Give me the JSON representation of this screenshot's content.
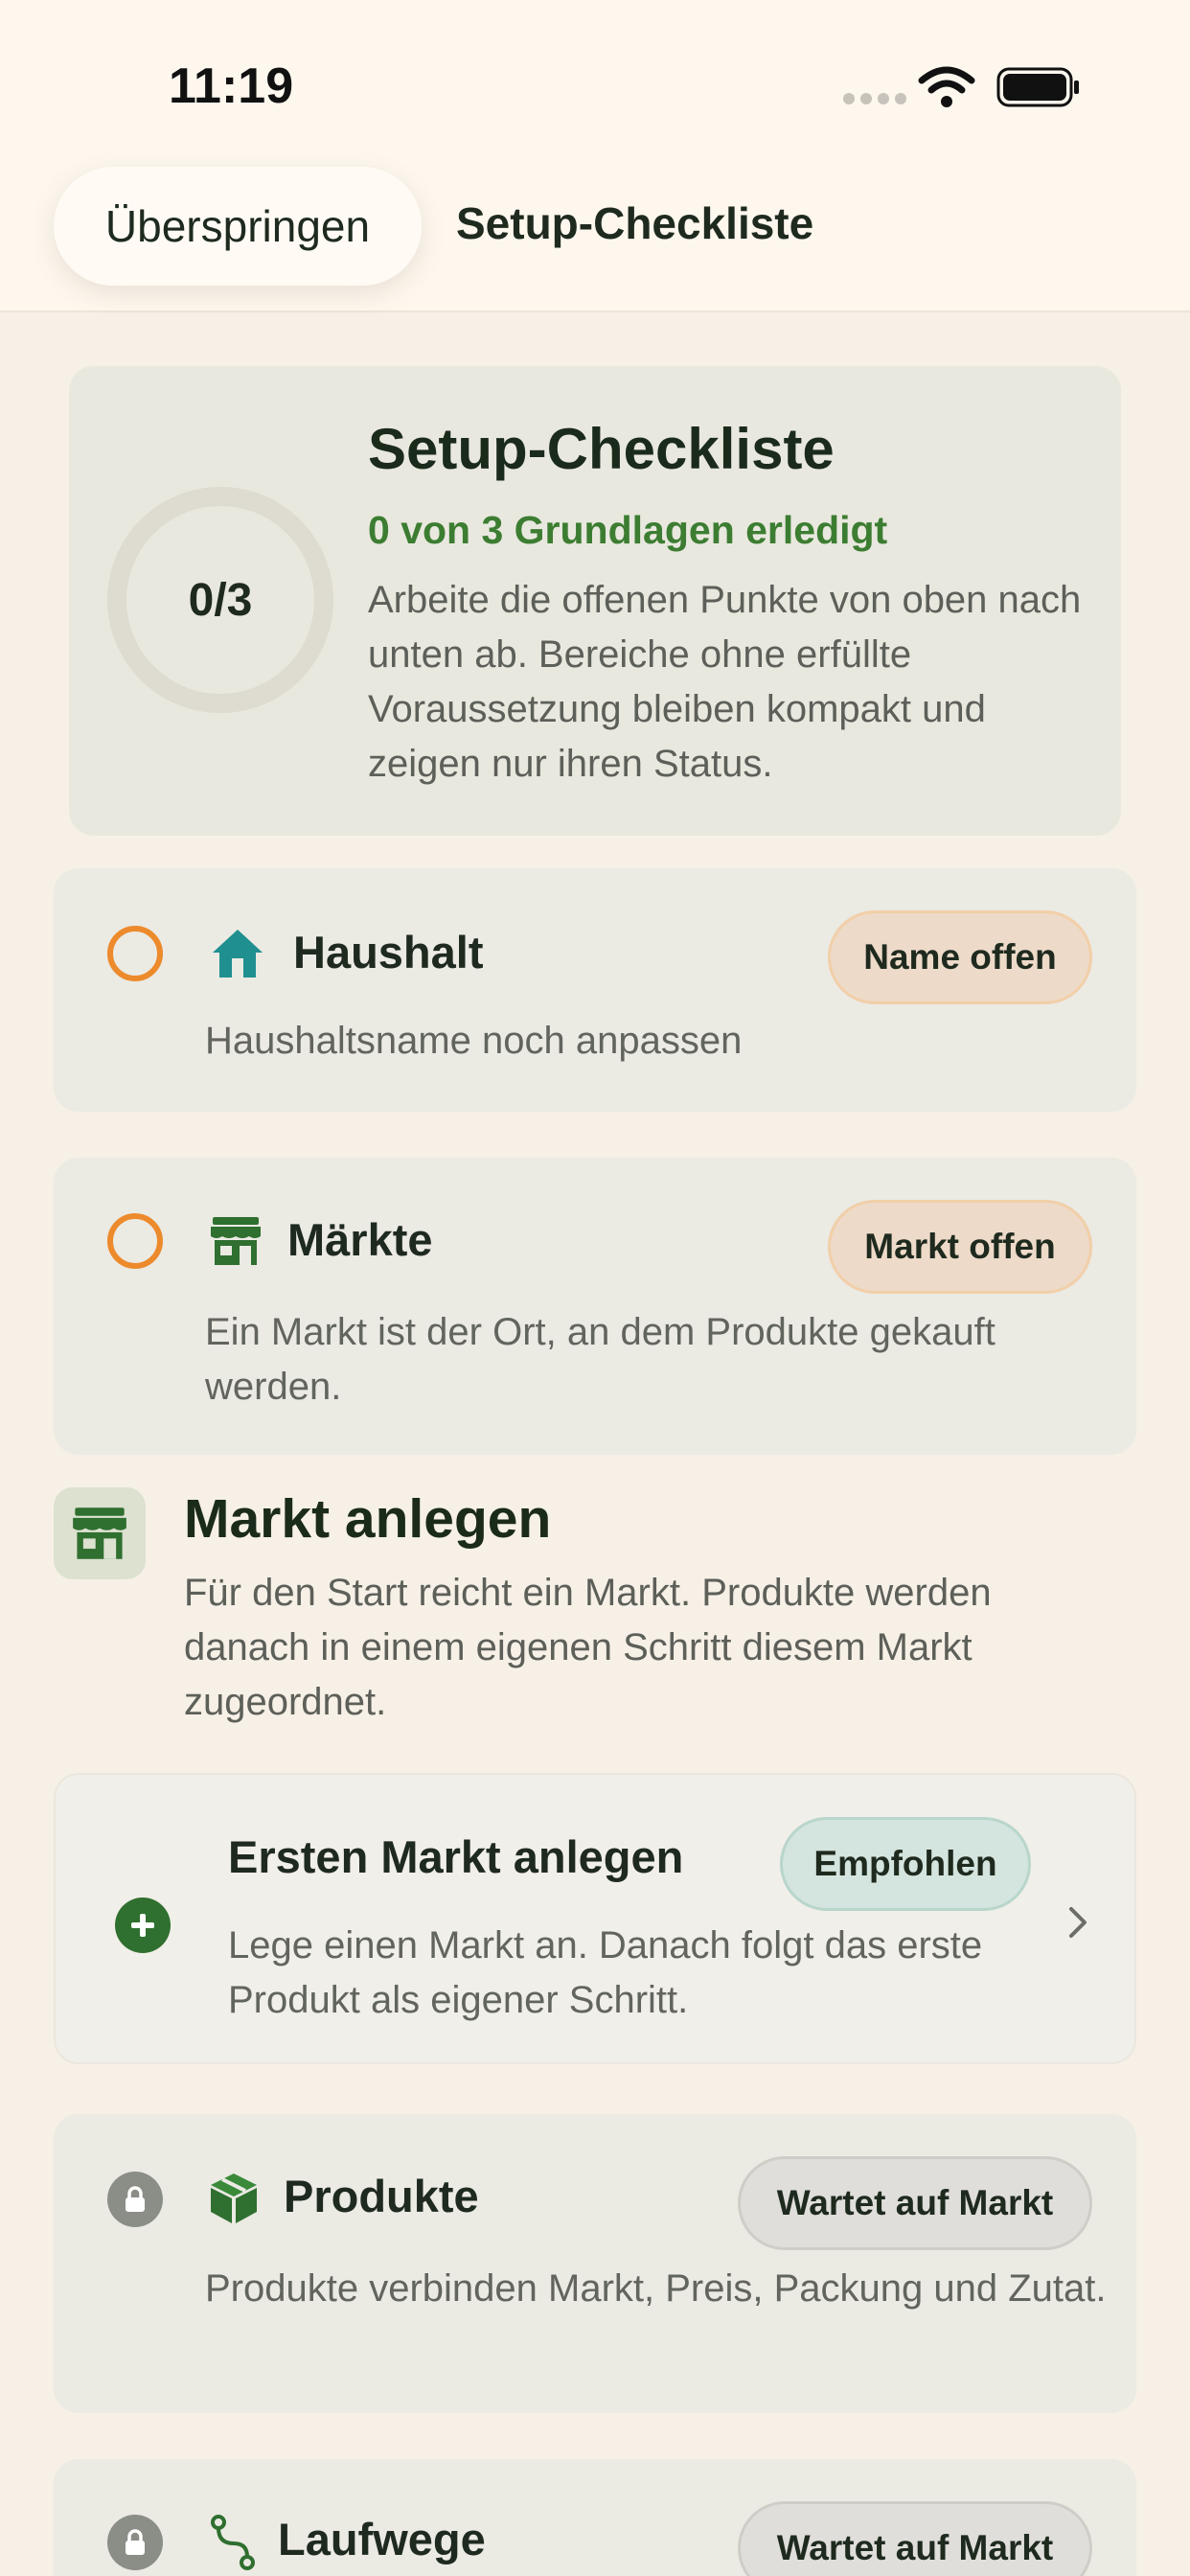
{
  "status_bar": {
    "time": "11:19"
  },
  "header": {
    "skip_label": "Überspringen",
    "title": "Setup-Checkliste"
  },
  "summary": {
    "progress_text": "0/3",
    "progress_fraction": 0,
    "title": "Setup-Checkliste",
    "subtitle": "0 von 3 Grundlagen erledigt",
    "description": "Arbeite die offenen Punkte von oben nach unten ab. Bereiche ohne erfüllte Voraussetzung bleiben kompakt und zeigen nur ihren Status."
  },
  "steps": {
    "household": {
      "icon": "house-icon",
      "title": "Haushalt",
      "badge": "Name offen",
      "description": "Haushaltsname noch anpassen"
    },
    "markets": {
      "icon": "store-icon",
      "title": "Märkte",
      "badge": "Markt offen",
      "description": "Ein Markt ist der Ort, an dem Produkte gekauft werden."
    },
    "products": {
      "icon": "box-icon",
      "title": "Produkte",
      "badge": "Wartet auf Markt",
      "description": "Produkte verbinden Markt, Preis, Packung und Zutat."
    },
    "routes": {
      "icon": "route-icon",
      "title": "Laufwege",
      "badge": "Wartet auf Markt"
    }
  },
  "section": {
    "title": "Markt anlegen",
    "description": "Für den Start reicht ein Markt. Produkte werden danach in einem eigenen Schritt diesem Markt zugeordnet."
  },
  "action": {
    "title": "Ersten Markt anlegen",
    "badge": "Empfohlen",
    "description": "Lege einen Markt an. Danach folgt das erste Produkt als eigener Schritt."
  },
  "colors": {
    "accent_green": "#3c7d32",
    "status_open": "#ec8a2c",
    "teal": "#1f8f8f",
    "background": "#f6f0e6"
  }
}
